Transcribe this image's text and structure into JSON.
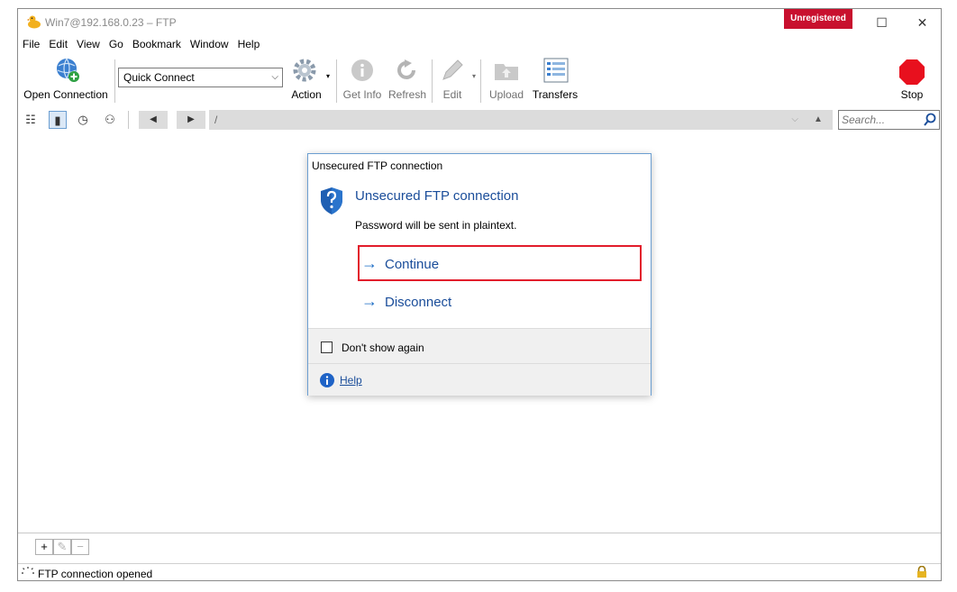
{
  "window": {
    "title": "Win7@192.168.0.23 – FTP",
    "badge": "Unregistered",
    "minimize_glyph": "",
    "maximize_glyph": "☐",
    "close_glyph": "✕"
  },
  "menu": [
    "File",
    "Edit",
    "View",
    "Go",
    "Bookmark",
    "Window",
    "Help"
  ],
  "toolbar": {
    "open_connection": "Open Connection",
    "quick_connect": "Quick Connect",
    "action": "Action",
    "get_info": "Get Info",
    "refresh": "Refresh",
    "edit": "Edit",
    "upload": "Upload",
    "transfers": "Transfers",
    "stop": "Stop"
  },
  "navbar": {
    "path": "/",
    "search_placeholder": "Search..."
  },
  "dialog": {
    "title": "Unsecured FTP connection",
    "heading": "Unsecured FTP connection",
    "message": "Password will be sent in plaintext.",
    "continue": "Continue",
    "disconnect": "Disconnect",
    "dont_show": "Don't show again",
    "help": "Help"
  },
  "bottombar": {
    "add": "+",
    "edit": "✎",
    "remove": "−"
  },
  "status": {
    "text": "FTP connection opened"
  },
  "colors": {
    "accent": "#1a4d9a",
    "badge": "#c8102e",
    "focus": "#e21c2b",
    "stop": "#e8101e"
  },
  "icons": [
    "app-duck-icon",
    "globe-icon",
    "gear-icon",
    "info-icon",
    "refresh-icon",
    "pencil-icon",
    "upload-icon",
    "transfers-icon",
    "stop-icon",
    "shield-question-icon",
    "arrow-right-icon",
    "lock-icon"
  ]
}
